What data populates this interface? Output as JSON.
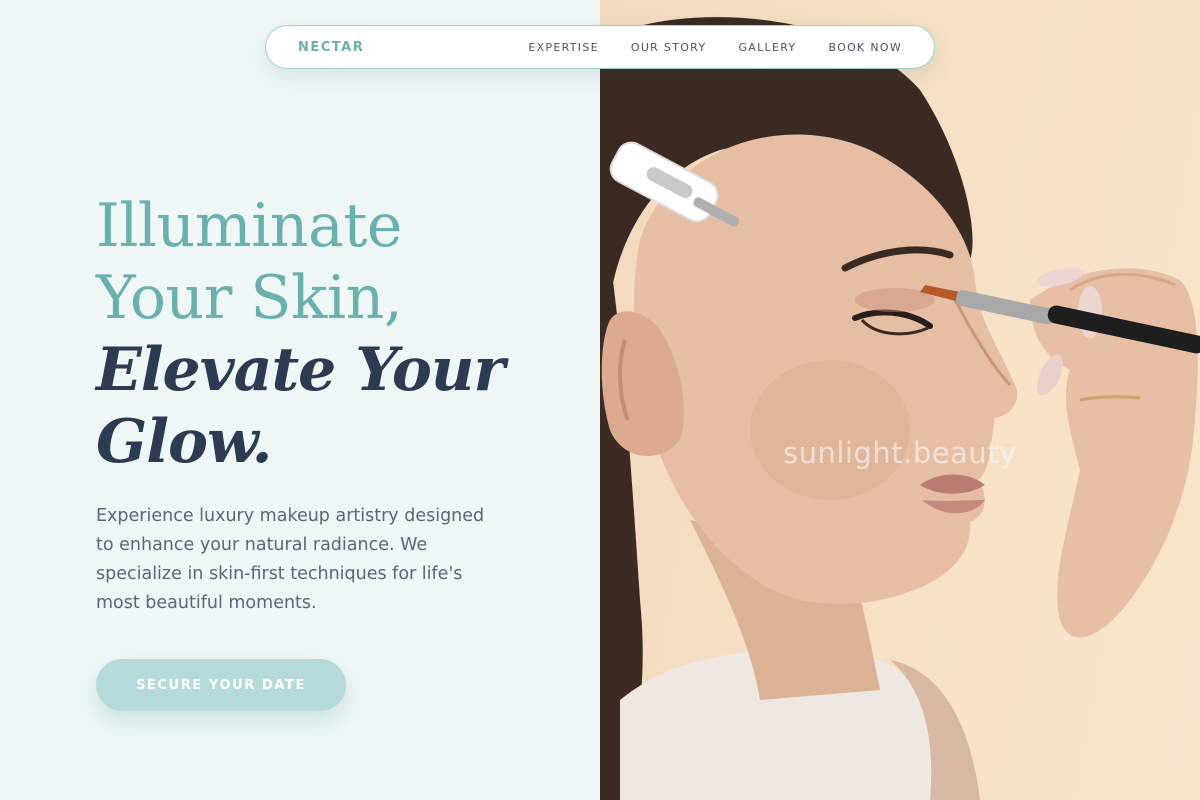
{
  "nav": {
    "brand": "NECTAR",
    "links": [
      "EXPERTISE",
      "OUR STORY",
      "GALLERY",
      "BOOK NOW"
    ]
  },
  "hero": {
    "headline_line1": "Illuminate",
    "headline_line2": "Your Skin,",
    "headline_line3": "Elevate Your",
    "headline_line4": "Glow.",
    "description": "Experience luxury makeup artistry designed to enhance your natural radiance. We specialize in skin-first techniques for life's most beautiful moments.",
    "cta_label": "SECURE YOUR DATE"
  },
  "image": {
    "watermark": "sunlight.beauty"
  },
  "colors": {
    "accent": "#6ab0ad",
    "dark_text": "#2c3a52",
    "body_text": "#5b6577",
    "panel_bg": "#eef7f6",
    "button_bg": "#b4dad9"
  }
}
